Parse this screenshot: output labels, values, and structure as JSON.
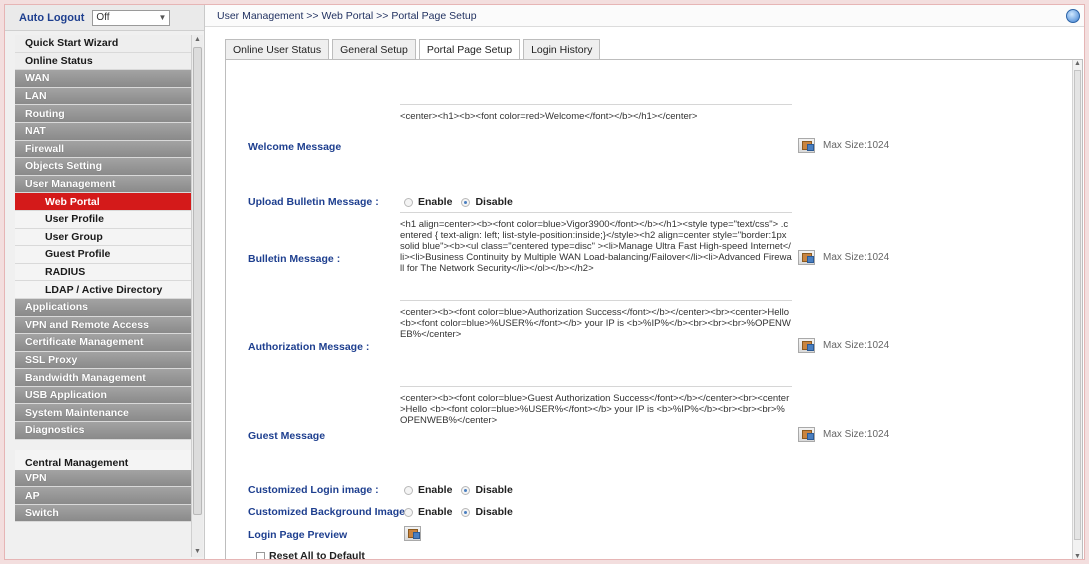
{
  "sidebar": {
    "auto_logout_label": "Auto Logout",
    "auto_logout_value": "Off",
    "items": [
      {
        "label": "Quick Start Wizard",
        "style": "light"
      },
      {
        "label": "Online Status",
        "style": "light"
      },
      {
        "label": "WAN",
        "style": "dark"
      },
      {
        "label": "LAN",
        "style": "dark"
      },
      {
        "label": "Routing",
        "style": "dark"
      },
      {
        "label": "NAT",
        "style": "dark"
      },
      {
        "label": "Firewall",
        "style": "dark"
      },
      {
        "label": "Objects Setting",
        "style": "dark"
      },
      {
        "label": "User Management",
        "style": "dark"
      },
      {
        "label": "Web Portal",
        "style": "active"
      },
      {
        "label": "User Profile",
        "style": "sub"
      },
      {
        "label": "User Group",
        "style": "sub"
      },
      {
        "label": "Guest Profile",
        "style": "sub"
      },
      {
        "label": "RADIUS",
        "style": "sub"
      },
      {
        "label": "LDAP / Active Directory",
        "style": "sub"
      },
      {
        "label": "Applications",
        "style": "dark"
      },
      {
        "label": "VPN and Remote Access",
        "style": "dark"
      },
      {
        "label": "Certificate Management",
        "style": "dark"
      },
      {
        "label": "SSL Proxy",
        "style": "dark"
      },
      {
        "label": "Bandwidth Management",
        "style": "dark"
      },
      {
        "label": "USB Application",
        "style": "dark"
      },
      {
        "label": "System Maintenance",
        "style": "dark"
      },
      {
        "label": "Diagnostics",
        "style": "dark"
      }
    ],
    "central_label": "Central Management",
    "central_items": [
      "VPN",
      "AP",
      "Switch"
    ]
  },
  "breadcrumb": "User Management >> Web Portal >> Portal Page Setup",
  "tabs": [
    {
      "label": "Online User Status",
      "active": false
    },
    {
      "label": "General Setup",
      "active": false
    },
    {
      "label": "Portal Page Setup",
      "active": true
    },
    {
      "label": "Login History",
      "active": false
    }
  ],
  "form": {
    "welcome": {
      "label": "Welcome Message",
      "value": "<center><h1><b><font color=red>Welcome</font></b></h1></center>",
      "max": "Max Size:1024"
    },
    "upload_bulletin": {
      "label": "Upload Bulletin Message :",
      "enable": "Enable",
      "disable": "Disable",
      "selected": "disable"
    },
    "bulletin": {
      "label": "Bulletin Message :",
      "value": "<h1 align=center><b><font color=blue>Vigor3900</font></b></h1><style type=\"text/css\"> .centered { text-align: left; list-style-position:inside;}</style><h2 align=center style=\"border:1px solid blue\"><b><ul class=\"centered type=disc\" ><li>Manage Ultra Fast High-speed Internet</li><li>Business Continuity by Multiple WAN Load-balancing/Failover</li><li>Advanced Firewall for The Network Security</li></ol></b></h2>",
      "max": "Max Size:1024"
    },
    "authorization": {
      "label": "Authorization Message :",
      "value": "<center><b><font color=blue>Authorization Success</font></b></center><br><center>Hello <b><font color=blue>%USER%</font></b> your IP is <b>%IP%</b><br><br><br>%OPENWEB%</center>",
      "max": "Max Size:1024"
    },
    "guest": {
      "label": "Guest Message",
      "value": "<center><b><font color=blue>Guest Authorization Success</font></b></center><br><center>Hello <b><font color=blue>%USER%</font></b> your IP is <b>%IP%</b><br><br><br>%OPENWEB%</center>",
      "max": "Max Size:1024"
    },
    "login_image": {
      "label": "Customized Login image :",
      "enable": "Enable",
      "disable": "Disable",
      "selected": "disable"
    },
    "background_image": {
      "label": "Customized Background Image",
      "enable": "Enable",
      "disable": "Disable",
      "selected": "disable"
    },
    "preview_label": "Login Page Preview",
    "reset_label": "Reset All to Default"
  },
  "colors": {
    "label_blue": "#1e3f8f",
    "active_red": "#d41a1a",
    "menu_dark": "#939393"
  }
}
